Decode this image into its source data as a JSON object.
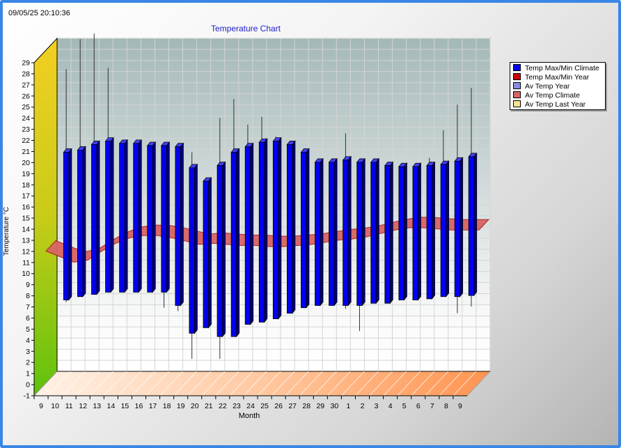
{
  "timestamp": "09/05/25 20:10:36",
  "chart_data": {
    "type": "bar",
    "title": "Temperature Chart",
    "xlabel": "Month",
    "ylabel": "Temperature °C",
    "ylim": [
      -1,
      29
    ],
    "y_ticks": [
      -1,
      0,
      1,
      2,
      3,
      4,
      5,
      6,
      7,
      8,
      9,
      10,
      11,
      12,
      13,
      14,
      15,
      16,
      17,
      18,
      19,
      20,
      21,
      22,
      23,
      24,
      25,
      26,
      27,
      28,
      29
    ],
    "categories": [
      "9",
      "10",
      "11",
      "12",
      "13",
      "14",
      "15",
      "16",
      "17",
      "18",
      "19",
      "20",
      "21",
      "22",
      "23",
      "24",
      "25",
      "26",
      "27",
      "28",
      "29",
      "30",
      "1",
      "2",
      "3",
      "4",
      "5",
      "6",
      "7",
      "8",
      "9"
    ],
    "grid": true,
    "legend_position": "right",
    "series": [
      {
        "name": "Temp Max/Min Climate",
        "color": "#0000ee",
        "low": [
          null,
          6.5,
          6.8,
          7,
          7.2,
          7.2,
          7.2,
          7.2,
          7.2,
          6,
          3.5,
          4,
          3.2,
          3.2,
          4.3,
          4.5,
          4.8,
          5.3,
          5.8,
          6,
          6,
          6,
          6,
          6.2,
          6.2,
          6.5,
          6.5,
          6.6,
          6.8,
          6.8,
          6.9
        ],
        "high": [
          null,
          19.8,
          20,
          20.5,
          20.8,
          20.6,
          20.6,
          20.4,
          20.4,
          20.3,
          18.4,
          17.2,
          18.6,
          19.8,
          20.3,
          20.7,
          20.8,
          20.5,
          19.8,
          18.9,
          18.9,
          19.1,
          18.9,
          18.9,
          18.6,
          18.5,
          18.5,
          18.6,
          18.7,
          19,
          19.4
        ]
      },
      {
        "name": "Temp Max/Min Year",
        "color": "#d00000",
        "low": [
          null,
          6.3,
          null,
          null,
          null,
          null,
          null,
          null,
          5.8,
          5.5,
          1.2,
          null,
          1.2,
          null,
          null,
          null,
          null,
          null,
          null,
          null,
          null,
          5.7,
          3.7,
          null,
          null,
          null,
          null,
          null,
          null,
          5.3,
          5.9
        ],
        "high": [
          null,
          27.3,
          30,
          30.5,
          27.4,
          null,
          null,
          null,
          null,
          null,
          19.8,
          null,
          22.9,
          24.6,
          22.3,
          23,
          21.2,
          null,
          null,
          null,
          null,
          21.5,
          null,
          null,
          null,
          null,
          null,
          19.3,
          21.8,
          24.1,
          25.6
        ]
      },
      {
        "name": "Av Temp Year",
        "color": "#8a8ae8",
        "values": []
      },
      {
        "name": "Av Temp Climate",
        "color": "#d86464",
        "values": [
          10.9,
          10.4,
          9.9,
          10.1,
          10.9,
          11.6,
          12.1,
          12.3,
          12.3,
          12.1,
          11.8,
          11.5,
          11.6,
          11.5,
          11.4,
          11.4,
          11.3,
          11.3,
          11.4,
          11.5,
          11.7,
          11.9,
          12,
          12.2,
          12.5,
          12.8,
          13,
          13,
          12.9,
          12.8,
          12.8,
          12.8
        ]
      },
      {
        "name": "Av Temp Last Year",
        "color": "#f4e48c",
        "values": []
      }
    ]
  }
}
